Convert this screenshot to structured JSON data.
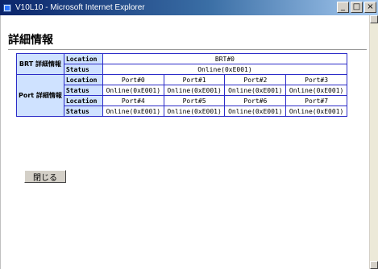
{
  "window": {
    "title": "V10L10 - Microsoft Internet Explorer",
    "buttons": [
      "_",
      "□",
      "×"
    ]
  },
  "page": {
    "heading": "詳細情報"
  },
  "brt": {
    "label": "BRT 詳細情報",
    "location_label": "Location",
    "status_label": "Status",
    "location_value": "BRT#0",
    "status_value": "Online(0xE001)"
  },
  "port": {
    "label": "Port 詳細情報",
    "location_label": "Location",
    "status_label": "Status",
    "rows": [
      {
        "locations": [
          "Port#0",
          "Port#1",
          "Port#2",
          "Port#3"
        ],
        "statuses": [
          "Online(0xE001)",
          "Online(0xE001)",
          "Online(0xE001)",
          "Online(0xE001)"
        ]
      },
      {
        "locations": [
          "Port#4",
          "Port#5",
          "Port#6",
          "Port#7"
        ],
        "statuses": [
          "Online(0xE001)",
          "Online(0xE001)",
          "Online(0xE001)",
          "Online(0xE001)"
        ]
      }
    ]
  },
  "actions": {
    "close_label": "閉じる"
  },
  "colors": {
    "table_border": "#2c2cc8",
    "label_bg": "#cfe2ff"
  }
}
